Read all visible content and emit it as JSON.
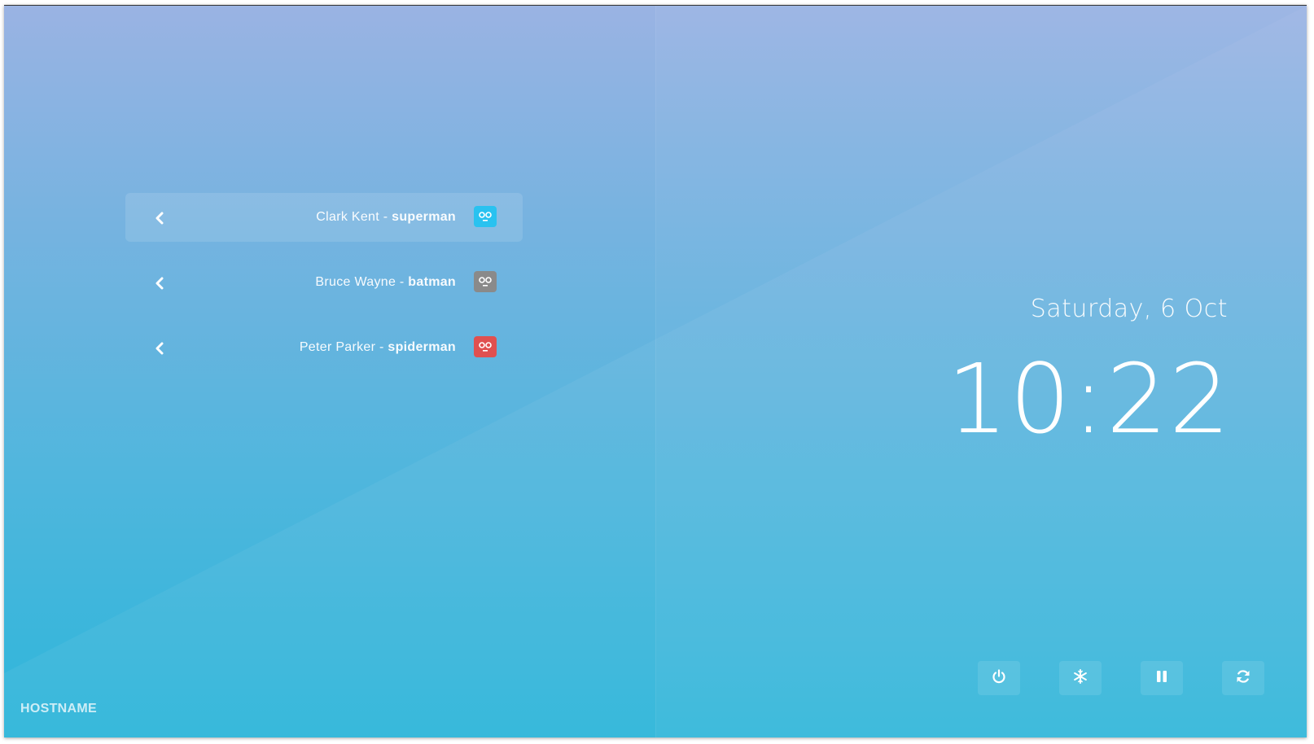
{
  "colors": {
    "avatar_superman": "#29c2f0",
    "avatar_batman": "#8a8a8a",
    "avatar_spiderman": "#e05050"
  },
  "users": [
    {
      "full_name": "Clark Kent",
      "separator": " - ",
      "username": "superman",
      "avatar_icon": "robot-face-icon",
      "selected": true
    },
    {
      "full_name": "Bruce Wayne",
      "separator": " - ",
      "username": "batman",
      "avatar_icon": "robot-face-icon",
      "selected": false
    },
    {
      "full_name": "Peter Parker",
      "separator": " - ",
      "username": "spiderman",
      "avatar_icon": "robot-face-icon",
      "selected": false
    }
  ],
  "hostname": "HOSTNAME",
  "date": "Saturday, 6 Oct",
  "time": "10:22",
  "power_buttons": [
    {
      "name": "shutdown",
      "icon": "power-icon"
    },
    {
      "name": "suspend",
      "icon": "snowflake-icon"
    },
    {
      "name": "hibernate",
      "icon": "pause-icon"
    },
    {
      "name": "restart",
      "icon": "refresh-icon"
    }
  ]
}
